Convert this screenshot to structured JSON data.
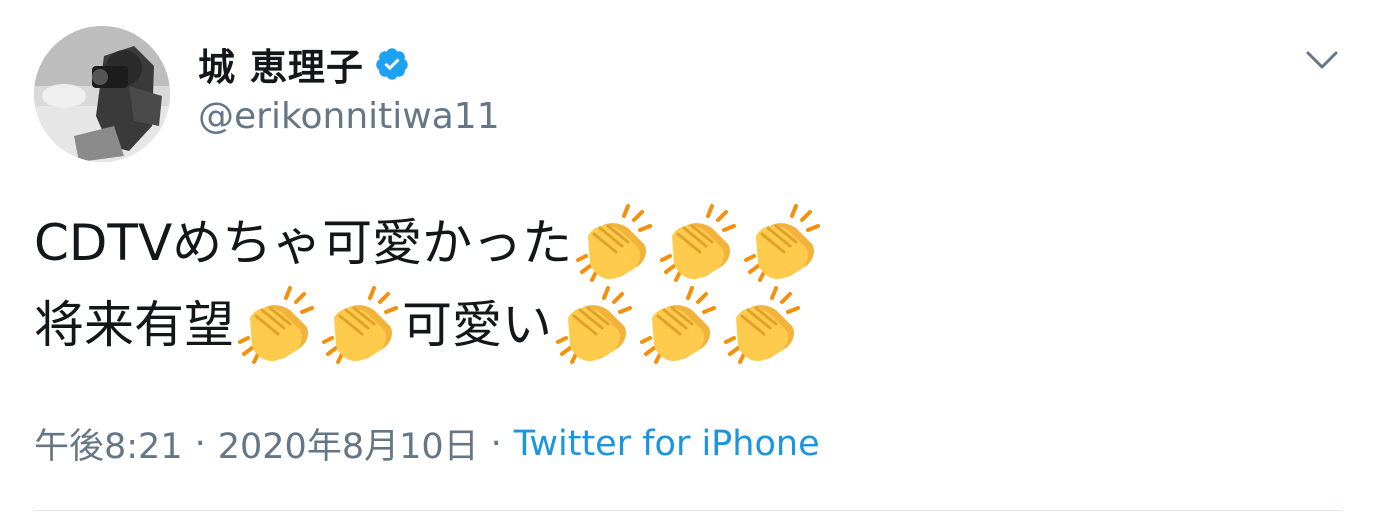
{
  "tweet": {
    "author": {
      "display_name": "城 恵理子",
      "handle": "@erikonnitiwa11",
      "verified": true,
      "avatar_icon": "profile-photo"
    },
    "caret_icon": "chevron-down-icon",
    "body": {
      "line1_text": "CDTVめちゃ可愛かった",
      "line1_emoji_count": 3,
      "line2_text_a": "将来有望",
      "line2_emoji_count_a": 2,
      "line2_text_b": "可愛い",
      "line2_emoji_count_b": 3,
      "emoji_name": "clapping-hands"
    },
    "meta": {
      "time": "午後8:21",
      "separator": "·",
      "date": "2020年8月10日",
      "source": "Twitter for iPhone"
    }
  },
  "colors": {
    "text": "#14171a",
    "secondary": "#657786",
    "link": "#1b95e0",
    "verified": "#1da1f2",
    "emoji_hand": "#ffcb4c",
    "emoji_spark": "#f4900c"
  }
}
